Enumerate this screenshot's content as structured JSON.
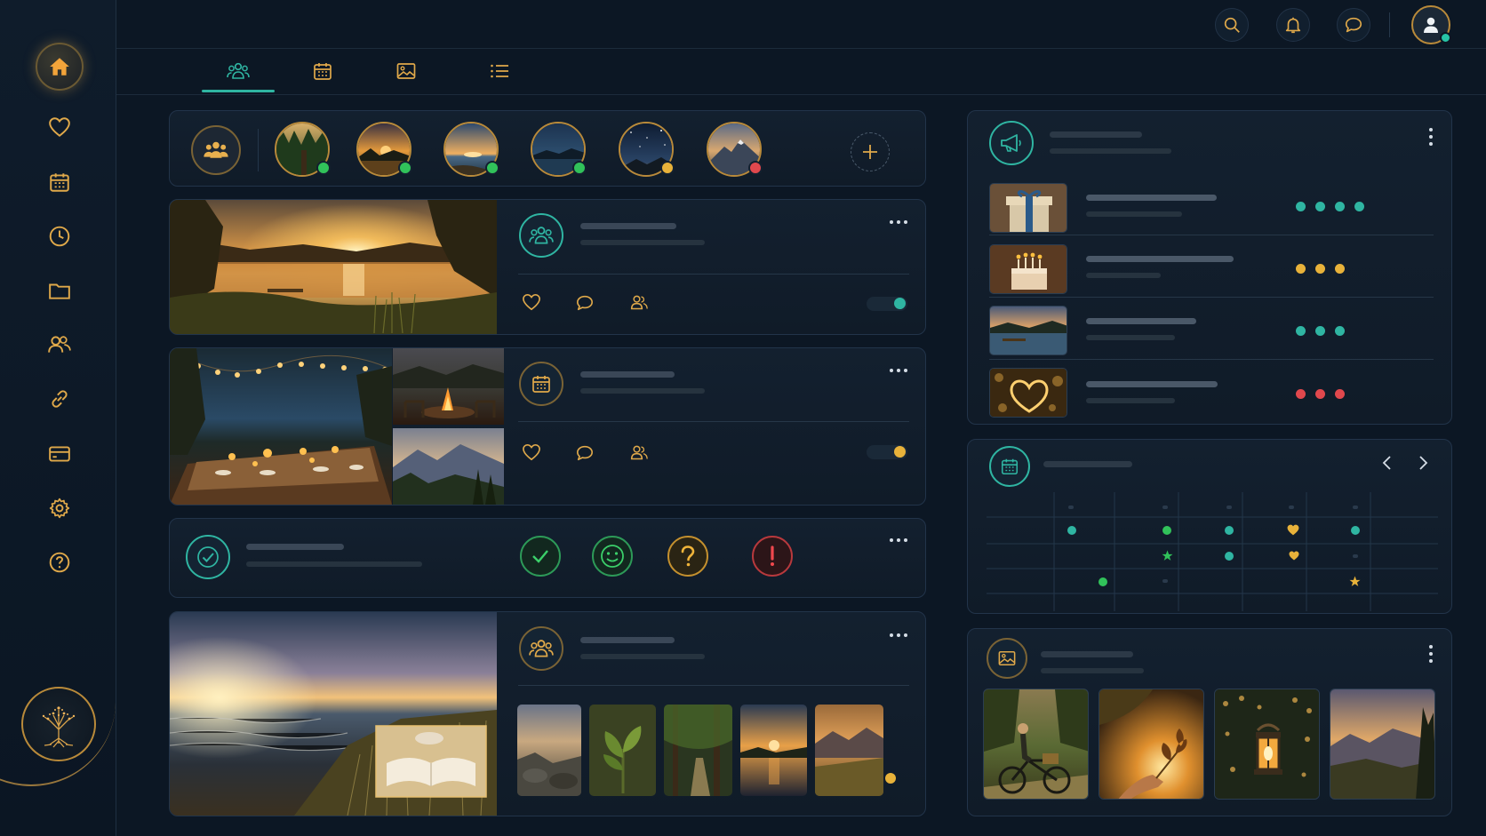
{
  "colors": {
    "accent_gold": "#e0a94a",
    "accent_teal": "#2fb5a2",
    "green": "#31c25a",
    "yellow": "#e8b23a",
    "red": "#e0484d",
    "background": "#0c1724"
  },
  "sidebar": {
    "items": [
      {
        "icon": "home-icon",
        "active": true
      },
      {
        "icon": "heart-icon"
      },
      {
        "icon": "calendar-icon"
      },
      {
        "icon": "clock-icon"
      },
      {
        "icon": "folder-icon"
      },
      {
        "icon": "users-icon"
      },
      {
        "icon": "link-icon"
      },
      {
        "icon": "card-icon"
      },
      {
        "icon": "gear-icon"
      },
      {
        "icon": "help-icon"
      }
    ],
    "logo": "tree-of-life-logo"
  },
  "topbar": {
    "icons": [
      "search-icon",
      "bell-icon",
      "chat-icon"
    ],
    "user": {
      "status": "online"
    }
  },
  "tabs": [
    {
      "icon": "group-icon",
      "active": true
    },
    {
      "icon": "calendar-icon"
    },
    {
      "icon": "image-icon"
    },
    {
      "icon": "list-icon"
    }
  ],
  "stories": [
    {
      "scene": "forest",
      "status": "green"
    },
    {
      "scene": "sunset-lake",
      "status": "green"
    },
    {
      "scene": "ocean-sunrise",
      "status": "green"
    },
    {
      "scene": "night-lake",
      "status": "green"
    },
    {
      "scene": "starry-sky",
      "status": "yellow"
    },
    {
      "scene": "mountain",
      "status": "red"
    }
  ],
  "posts": [
    {
      "icon": "group-icon",
      "toggle": "teal"
    },
    {
      "icon": "calendar-icon",
      "toggle": "yellow"
    },
    {
      "icon": "group-icon",
      "thumb_indicator": "yellow"
    }
  ],
  "mood_check": {
    "options": [
      "check-icon",
      "smile-icon",
      "question-icon",
      "alert-icon"
    ]
  },
  "announcements": {
    "items": [
      {
        "thumb": "gift",
        "dots": [
          "teal",
          "teal",
          "teal",
          "teal"
        ]
      },
      {
        "thumb": "birthday-cake",
        "dots": [
          "yellow",
          "yellow",
          "yellow"
        ]
      },
      {
        "thumb": "lake-dock",
        "dots": [
          "teal",
          "teal",
          "teal"
        ]
      },
      {
        "thumb": "glowing-heart",
        "dots": [
          "red",
          "red",
          "red"
        ]
      }
    ]
  },
  "calendar_widget": {
    "nav": [
      "chevron-left-icon",
      "chevron-right-icon"
    ]
  },
  "gallery": {
    "photos": [
      "cyclist-meadow",
      "leaf-sunlight",
      "lantern-bokeh",
      "mountain-sunset"
    ]
  }
}
